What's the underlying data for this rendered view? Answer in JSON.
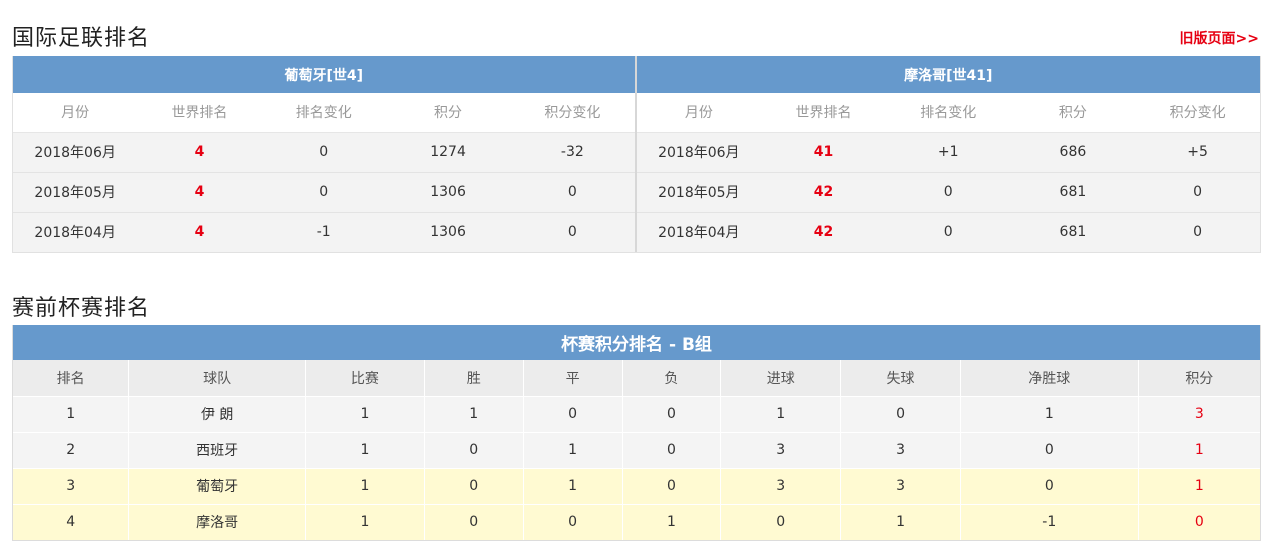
{
  "fifa": {
    "title": "国际足联排名",
    "old_link": "旧版页面>>",
    "columns": [
      "月份",
      "世界排名",
      "排名变化",
      "积分",
      "积分变化"
    ],
    "teams": [
      {
        "header": "葡萄牙[世4]",
        "rows": [
          {
            "month": "2018年06月",
            "rank": "4",
            "rank_change": "0",
            "points": "1274",
            "points_change": "-32"
          },
          {
            "month": "2018年05月",
            "rank": "4",
            "rank_change": "0",
            "points": "1306",
            "points_change": "0"
          },
          {
            "month": "2018年04月",
            "rank": "4",
            "rank_change": "-1",
            "points": "1306",
            "points_change": "0"
          }
        ]
      },
      {
        "header": "摩洛哥[世41]",
        "rows": [
          {
            "month": "2018年06月",
            "rank": "41",
            "rank_change": "+1",
            "points": "686",
            "points_change": "+5"
          },
          {
            "month": "2018年05月",
            "rank": "42",
            "rank_change": "0",
            "points": "681",
            "points_change": "0"
          },
          {
            "month": "2018年04月",
            "rank": "42",
            "rank_change": "0",
            "points": "681",
            "points_change": "0"
          }
        ]
      }
    ]
  },
  "cup": {
    "title": "赛前杯赛排名",
    "table_title": "杯赛积分排名 - B组",
    "columns": [
      "排名",
      "球队",
      "比赛",
      "胜",
      "平",
      "负",
      "进球",
      "失球",
      "净胜球",
      "积分"
    ],
    "rows": [
      {
        "rank": "1",
        "team": "伊 朗",
        "played": "1",
        "won": "1",
        "drawn": "0",
        "lost": "0",
        "gf": "1",
        "ga": "0",
        "gd": "1",
        "pts": "3",
        "highlight": false
      },
      {
        "rank": "2",
        "team": "西班牙",
        "played": "1",
        "won": "0",
        "drawn": "1",
        "lost": "0",
        "gf": "3",
        "ga": "3",
        "gd": "0",
        "pts": "1",
        "highlight": false
      },
      {
        "rank": "3",
        "team": "葡萄牙",
        "played": "1",
        "won": "0",
        "drawn": "1",
        "lost": "0",
        "gf": "3",
        "ga": "3",
        "gd": "0",
        "pts": "1",
        "highlight": true
      },
      {
        "rank": "4",
        "team": "摩洛哥",
        "played": "1",
        "won": "0",
        "drawn": "0",
        "lost": "1",
        "gf": "0",
        "ga": "1",
        "gd": "-1",
        "pts": "0",
        "highlight": true
      }
    ]
  },
  "colors": {
    "header_blue": "#6699cc",
    "accent_red": "#e60012",
    "highlight_yellow": "#fffad2"
  }
}
